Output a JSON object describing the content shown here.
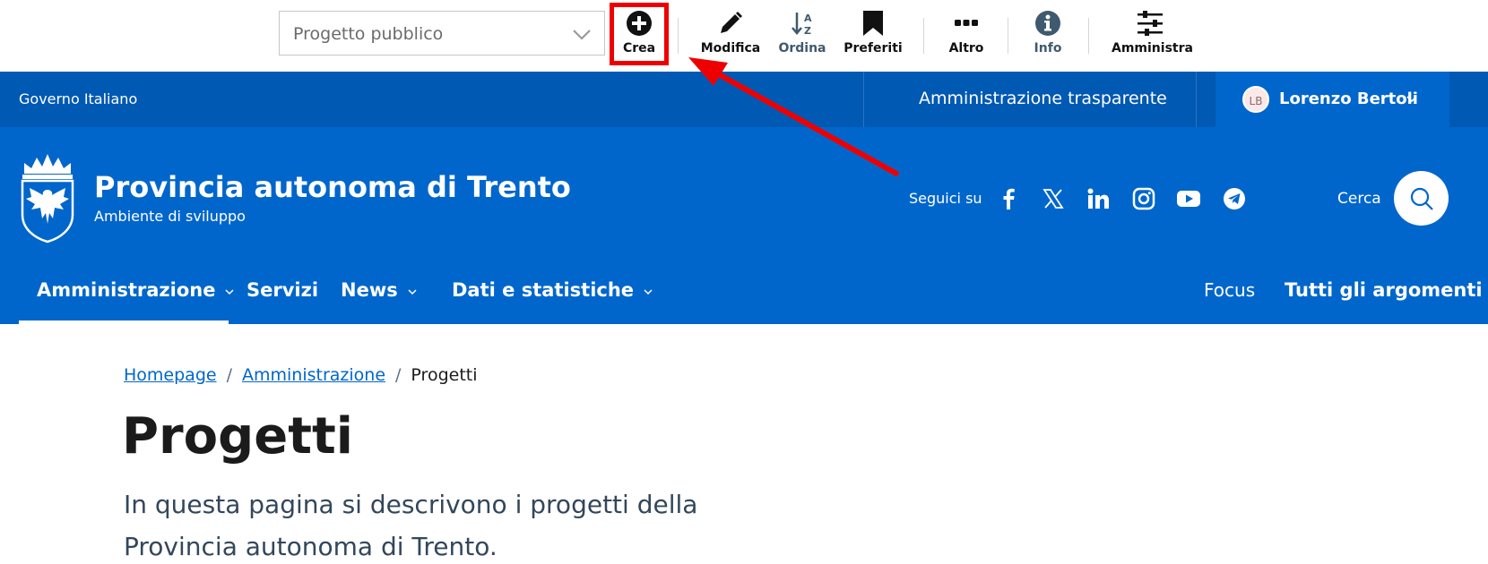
{
  "toolbar": {
    "select_value": "Progetto pubblico",
    "buttons": {
      "crea": "Crea",
      "modifica": "Modifica",
      "ordina": "Ordina",
      "preferiti": "Preferiti",
      "altro": "Altro",
      "info": "Info",
      "amministra": "Amministra"
    }
  },
  "slim_header": {
    "left_label": "Governo Italiano",
    "transparent_label": "Amministrazione trasparente",
    "user": {
      "initials": "LB",
      "name": "Lorenzo Bertoli"
    }
  },
  "center_header": {
    "title": "Provincia autonoma di Trento",
    "subtitle": "Ambiente di sviluppo",
    "social_label": "Seguici su",
    "social_icons": [
      "facebook-icon",
      "x-icon",
      "linkedin-icon",
      "instagram-icon",
      "youtube-icon",
      "telegram-icon"
    ],
    "search_label": "Cerca"
  },
  "navbar": {
    "items": [
      "Amministrazione",
      "Servizi",
      "News",
      "Dati e statistiche"
    ],
    "right_items": [
      "Focus",
      "Tutti gli argomenti"
    ]
  },
  "breadcrumb": [
    "Homepage",
    "Amministrazione",
    "Progetti"
  ],
  "page": {
    "title": "Progetti",
    "description": "In questa pagina si descrivono i progetti della Provincia autonoma di Trento."
  },
  "colors": {
    "slim_bg": "#0059b3",
    "header_bg": "#0066cc",
    "highlight": "#ef0000",
    "link": "#0066cc"
  }
}
